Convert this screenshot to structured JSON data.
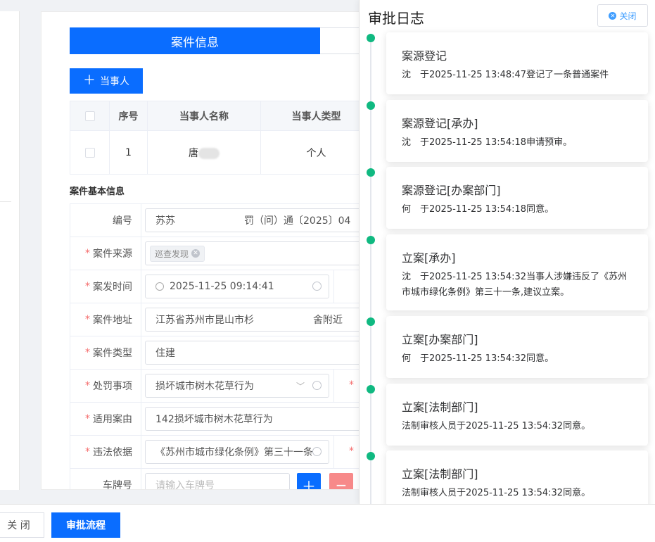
{
  "main": {
    "tab_active": "案件信息",
    "add_party_label": "当事人",
    "party_table": {
      "headers": [
        "序号",
        "当事人名称",
        "当事人类型"
      ],
      "rows": [
        {
          "index": "1",
          "name": "唐",
          "type": "个人"
        }
      ]
    },
    "section_title": "案件基本信息",
    "form": {
      "number": {
        "label": "编号",
        "value": "苏苏　　　　　　　罚（问）通〔2025〕04"
      },
      "source": {
        "label": "案件来源",
        "tag": "巡查发现"
      },
      "time": {
        "label": "案发时间",
        "value": "2025-11-25 09:14:41"
      },
      "address": {
        "label": "案件地址",
        "value": "江苏省苏州市昆山市杉　　　　　　舍附近"
      },
      "type": {
        "label": "案件类型",
        "value": "住建"
      },
      "penalty": {
        "label": "处罚事项",
        "value": "损坏城市树木花草行为"
      },
      "cause": {
        "label": "适用案由",
        "value": "142损坏城市树木花草行为"
      },
      "basis": {
        "label": "违法依据",
        "value": "《苏州市城市绿化条例》第三十一条"
      },
      "plate": {
        "label": "车牌号",
        "placeholder": "请输入车牌号"
      }
    }
  },
  "drawer": {
    "title": "审批日志",
    "close_label": "关闭",
    "logs": [
      {
        "title": "案源登记",
        "text": "沈　于2025-11-25 13:48:47登记了一条普通案件"
      },
      {
        "title": "案源登记[承办]",
        "text": "沈　于2025-11-25 13:54:18申请预审。"
      },
      {
        "title": "案源登记[办案部门]",
        "text": "何　于2025-11-25 13:54:18同意。"
      },
      {
        "title": "立案[承办]",
        "text": "沈　于2025-11-25 13:54:32当事人涉嫌违反了《苏州市城市绿化条例》第三十一条,建议立案。"
      },
      {
        "title": "立案[办案部门]",
        "text": "何　于2025-11-25 13:54:32同意。"
      },
      {
        "title": "立案[法制部门]",
        "text": "法制审核人员于2025-11-25 13:54:32同意。"
      },
      {
        "title": "立案[法制部门]",
        "text": "法制审核人员于2025-11-25 13:54:32同意。"
      }
    ]
  },
  "footer": {
    "close_label": "关 闭",
    "flow_label": "审批流程"
  },
  "colors": {
    "primary": "#0a6dff",
    "timeline_dot": "#10b981",
    "required": "#f56c6c"
  }
}
